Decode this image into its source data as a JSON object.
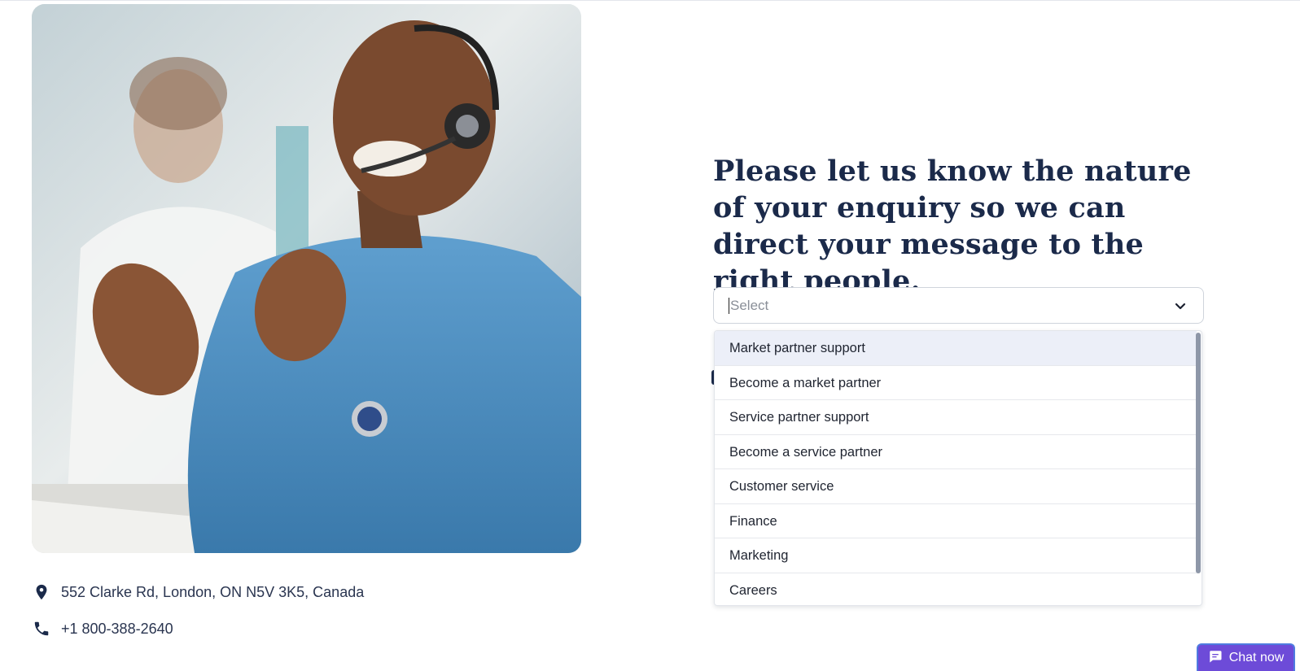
{
  "photo": {
    "alt_subject": "agent-with-headset",
    "icon": "customer-support-photo"
  },
  "contact": {
    "address": "552 Clarke Rd, London, ON N5V 3K5, Canada",
    "address_icon": "location-pin-icon",
    "phone": "+1 800-388-2640",
    "phone_icon": "phone-icon"
  },
  "form": {
    "heading": "Please let us know the nature of your enquiry so we can direct your message to the right people.",
    "select_placeholder": "Select",
    "select_icon": "chevron-down-icon",
    "options": [
      "Market partner support",
      "Become a market partner",
      "Service partner support",
      "Become a service partner",
      "Customer service",
      "Finance",
      "Marketing",
      "Careers"
    ],
    "highlighted_option": "Market partner support"
  },
  "chat": {
    "label": "Chat now",
    "icon": "chat-bubble-icon"
  },
  "colors": {
    "heading": "#1b2a4a",
    "chat_bg": "#6d4bd8",
    "option_highlight": "#eceff8"
  }
}
